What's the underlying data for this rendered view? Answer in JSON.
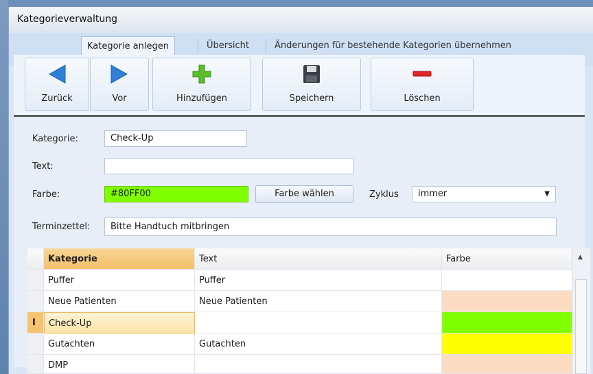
{
  "window": {
    "title": "Kategorieverwaltung"
  },
  "tabs": [
    {
      "label": "Kategorie anlegen",
      "active": true
    },
    {
      "label": "Übersicht",
      "active": false
    },
    {
      "label": "Änderungen für bestehende Kategorien übernehmen",
      "active": false
    }
  ],
  "toolbar": {
    "back_label": "Zurück",
    "forward_label": "Vor",
    "add_label": "Hinzufügen",
    "save_label": "Speichern",
    "delete_label": "Löschen",
    "icons": {
      "back": "arrow-left-icon",
      "forward": "arrow-right-icon",
      "add": "plus-icon",
      "save": "floppy-disk-icon",
      "delete": "minus-icon"
    }
  },
  "form": {
    "category_label": "Kategorie:",
    "category_value": "Check-Up",
    "text_label": "Text:",
    "text_value": "",
    "color_label": "Farbe:",
    "color_value": "#80FF00",
    "choose_color_label": "Farbe wählen",
    "cycle_label": "Zyklus",
    "cycle_value": "immer",
    "appointment_label": "Terminzettel:",
    "appointment_value": "Bitte Handtuch mitbringen"
  },
  "table": {
    "columns": [
      "Kategorie",
      "Text",
      "Farbe"
    ],
    "rows": [
      {
        "kategorie": "Puffer",
        "text": "Puffer",
        "farbe": ""
      },
      {
        "kategorie": "Neue Patienten",
        "text": "Neue Patienten",
        "farbe": "#fbdcc3"
      },
      {
        "kategorie": "Check-Up",
        "text": "",
        "farbe": "#80ff00",
        "selected": true
      },
      {
        "kategorie": "Gutachten",
        "text": "Gutachten",
        "farbe": "#ffff00"
      },
      {
        "kategorie": "DMP",
        "text": "",
        "farbe": "#fbdcc3"
      }
    ]
  },
  "colors": {
    "selected_row": "#fde3a7",
    "header_active": "#f3bf6a",
    "accent_blue": "#2f7fd8"
  }
}
